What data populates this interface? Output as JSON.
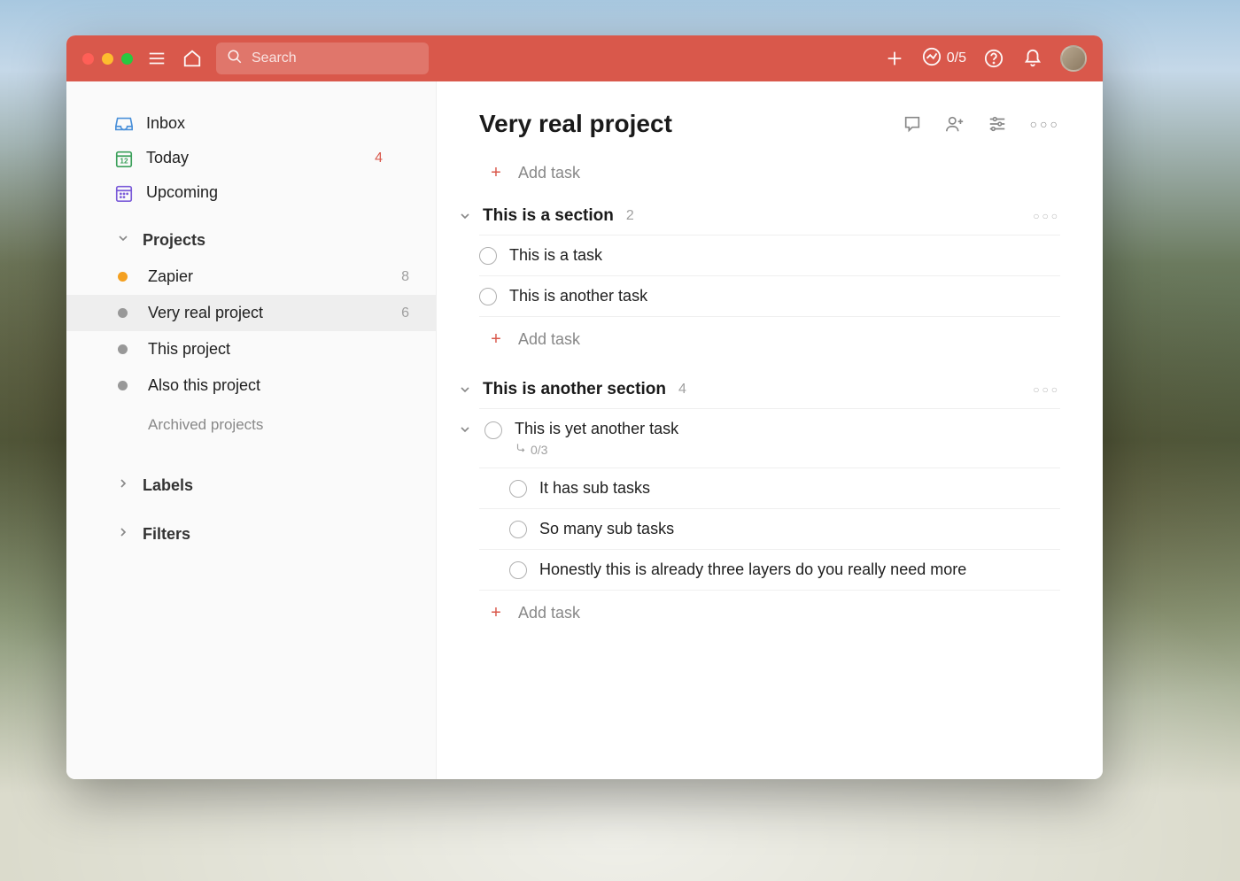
{
  "topbar": {
    "search_placeholder": "Search",
    "progress_count": "0/5"
  },
  "sidebar": {
    "nav": [
      {
        "label": "Inbox",
        "count": "",
        "count_class": ""
      },
      {
        "label": "Today",
        "count": "4",
        "count_class": "count-red"
      },
      {
        "label": "Upcoming",
        "count": "",
        "count_class": ""
      }
    ],
    "projects_header": "Projects",
    "projects": [
      {
        "label": "Zapier",
        "count": "8",
        "dot": "#f4a020",
        "active": false
      },
      {
        "label": "Very real project",
        "count": "6",
        "dot": "#989898",
        "active": true
      },
      {
        "label": "This project",
        "count": "",
        "dot": "#989898",
        "active": false
      },
      {
        "label": "Also this project",
        "count": "",
        "dot": "#989898",
        "active": false
      }
    ],
    "archived_label": "Archived projects",
    "labels_header": "Labels",
    "filters_header": "Filters"
  },
  "main": {
    "title": "Very real project",
    "add_task_label": "Add task",
    "sections": [
      {
        "title": "This is a section",
        "count": "2",
        "tasks": [
          {
            "label": "This is a task"
          },
          {
            "label": "This is another task"
          }
        ]
      },
      {
        "title": "This is another section",
        "count": "4",
        "tasks": [
          {
            "label": "This is yet another task",
            "subtask_progress": "0/3",
            "subtasks": [
              {
                "label": "It has sub tasks"
              },
              {
                "label": "So many sub tasks"
              },
              {
                "label": "Honestly this is already three layers do you really need more"
              }
            ]
          }
        ]
      }
    ]
  }
}
